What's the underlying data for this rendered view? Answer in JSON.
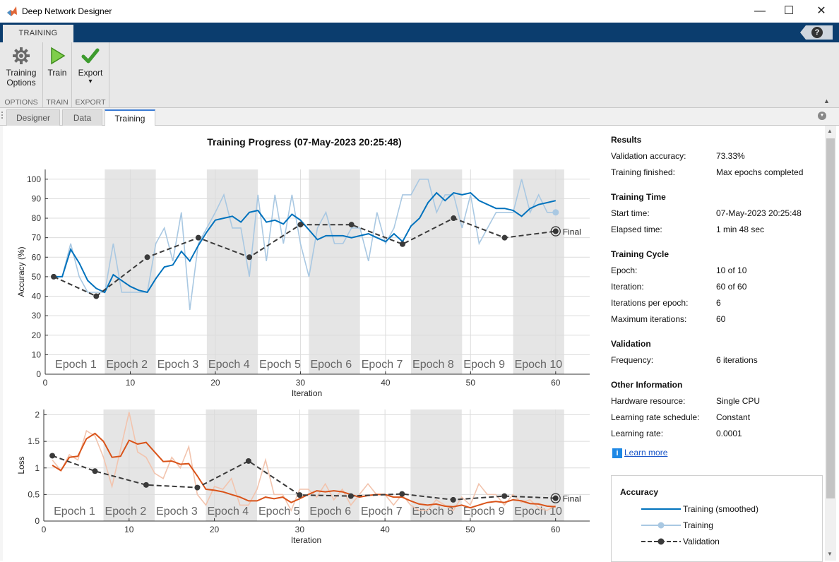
{
  "window": {
    "title": "Deep Network Designer",
    "minimize": "—",
    "maximize": "☐",
    "close": "✕"
  },
  "toolstrip": {
    "tab_label": "TRAINING",
    "help_label": "?",
    "groups": [
      {
        "label": "OPTIONS",
        "button": [
          "Training",
          "Options"
        ],
        "icon": "gear-icon"
      },
      {
        "label": "TRAIN",
        "button": [
          "Train"
        ],
        "icon": "play-icon"
      },
      {
        "label": "EXPORT",
        "button": [
          "Export",
          "▾"
        ],
        "icon": "checkmark-icon"
      }
    ]
  },
  "doc_tabs": [
    "Designer",
    "Data",
    "Training"
  ],
  "active_tab": "Training",
  "progress_title": "Training Progress (07-May-2023 20:25:48)",
  "info": {
    "sections": [
      {
        "title": "Results",
        "rows": [
          [
            "Validation accuracy:",
            "73.33%"
          ],
          [
            "Training finished:",
            "Max epochs completed"
          ]
        ]
      },
      {
        "title": "Training Time",
        "rows": [
          [
            "Start time:",
            "07-May-2023 20:25:48"
          ],
          [
            "Elapsed time:",
            "1 min 48 sec"
          ]
        ]
      },
      {
        "title": "Training Cycle",
        "rows": [
          [
            "Epoch:",
            "10 of 10"
          ],
          [
            "Iteration:",
            "60 of 60"
          ],
          [
            "Iterations per epoch:",
            "6"
          ],
          [
            "Maximum iterations:",
            "60"
          ]
        ]
      },
      {
        "title": "Validation",
        "rows": [
          [
            "Frequency:",
            "6 iterations"
          ]
        ]
      },
      {
        "title": "Other Information",
        "rows": [
          [
            "Hardware resource:",
            "Single CPU"
          ],
          [
            "Learning rate schedule:",
            "Constant"
          ],
          [
            "Learning rate:",
            "0.0001"
          ]
        ]
      }
    ],
    "learn_more": "Learn more"
  },
  "legend": {
    "title": "Accuracy",
    "entries": [
      "Training (smoothed)",
      "Training",
      "Validation"
    ]
  },
  "chart_data": [
    {
      "type": "line",
      "ylabel": "Accuracy (%)",
      "xlabel": "Iteration",
      "xlim": [
        0,
        64
      ],
      "ylim": [
        0,
        105
      ],
      "xticks": [
        0,
        10,
        20,
        30,
        40,
        50,
        60
      ],
      "yticks": [
        0,
        10,
        20,
        30,
        40,
        50,
        60,
        70,
        80,
        90,
        100
      ],
      "grid": true,
      "epoch_labels": [
        "Epoch 1",
        "Epoch 2",
        "Epoch 3",
        "Epoch 4",
        "Epoch 5",
        "Epoch 6",
        "Epoch 7",
        "Epoch 8",
        "Epoch 9",
        "Epoch 10"
      ],
      "colors": {
        "smoothed": "#0072bd",
        "raw": "#a9c8e2",
        "validation": "#3a3a3a",
        "shade": "#e5e5e5"
      },
      "series": [
        {
          "name": "Training (smoothed)",
          "x": [
            1,
            2,
            3,
            4,
            5,
            6,
            7,
            8,
            9,
            10,
            11,
            12,
            13,
            14,
            15,
            16,
            17,
            18,
            19,
            20,
            21,
            22,
            23,
            24,
            25,
            26,
            27,
            28,
            29,
            30,
            31,
            32,
            33,
            34,
            35,
            36,
            37,
            38,
            39,
            40,
            41,
            42,
            43,
            44,
            45,
            46,
            47,
            48,
            49,
            50,
            51,
            52,
            53,
            54,
            55,
            56,
            57,
            58,
            59,
            60
          ],
          "y": [
            50,
            50,
            64,
            57,
            48,
            44,
            42,
            51,
            48,
            45,
            43,
            42,
            49,
            55,
            56,
            63,
            58,
            66,
            73,
            79,
            80,
            81,
            78,
            83,
            84,
            78,
            79,
            77,
            82,
            79,
            74,
            69,
            71,
            71,
            71,
            70,
            71,
            72,
            70,
            68,
            72,
            68,
            76,
            80,
            88,
            93,
            89,
            93,
            92,
            93,
            89,
            87,
            85,
            85,
            84,
            81,
            85,
            87,
            88,
            89
          ]
        },
        {
          "name": "Training",
          "x": [
            1,
            2,
            3,
            4,
            5,
            6,
            7,
            8,
            9,
            10,
            11,
            12,
            13,
            14,
            15,
            16,
            17,
            18,
            19,
            20,
            21,
            22,
            23,
            24,
            25,
            26,
            27,
            28,
            29,
            30,
            31,
            32,
            33,
            34,
            35,
            36,
            37,
            38,
            39,
            40,
            41,
            42,
            43,
            44,
            45,
            46,
            47,
            48,
            49,
            50,
            51,
            52,
            53,
            54,
            55,
            56,
            57,
            58,
            59,
            60
          ],
          "y": [
            50,
            50,
            67,
            50,
            42,
            42,
            42,
            67,
            42,
            42,
            42,
            42,
            67,
            75,
            58,
            83,
            33,
            67,
            75,
            83,
            92,
            75,
            75,
            50,
            92,
            58,
            92,
            67,
            92,
            67,
            50,
            75,
            83,
            67,
            67,
            75,
            75,
            58,
            83,
            67,
            75,
            92,
            92,
            100,
            100,
            83,
            92,
            92,
            75,
            92,
            67,
            75,
            83,
            83,
            83,
            100,
            83,
            92,
            83,
            83
          ]
        },
        {
          "name": "Validation",
          "x": [
            1,
            6,
            12,
            18,
            24,
            30,
            36,
            42,
            48,
            54,
            60
          ],
          "y": [
            50,
            40,
            60,
            70,
            60,
            76.7,
            76.7,
            66.7,
            80,
            70,
            73.3
          ]
        }
      ],
      "annotation": "Final"
    },
    {
      "type": "line",
      "ylabel": "Loss",
      "xlabel": "Iteration",
      "xlim": [
        0,
        64
      ],
      "ylim": [
        0,
        2.1
      ],
      "xticks": [
        0,
        10,
        20,
        30,
        40,
        50,
        60
      ],
      "yticks": [
        0,
        0.5,
        1,
        1.5,
        2
      ],
      "ytick_labels": [
        "0",
        "0.5",
        "1",
        "1.5",
        "2"
      ],
      "grid": true,
      "epoch_labels": [
        "Epoch 1",
        "Epoch 2",
        "Epoch 3",
        "Epoch 4",
        "Epoch 5",
        "Epoch 6",
        "Epoch 7",
        "Epoch 8",
        "Epoch 9",
        "Epoch 10"
      ],
      "colors": {
        "smoothed": "#d95319",
        "raw": "#f2c4ae",
        "validation": "#3a3a3a",
        "shade": "#e5e5e5"
      },
      "series": [
        {
          "name": "Training (smoothed)",
          "x": [
            1,
            2,
            3,
            4,
            5,
            6,
            7,
            8,
            9,
            10,
            11,
            12,
            13,
            14,
            15,
            16,
            17,
            18,
            19,
            20,
            21,
            22,
            23,
            24,
            25,
            26,
            27,
            28,
            29,
            30,
            31,
            32,
            33,
            34,
            35,
            36,
            37,
            38,
            39,
            40,
            41,
            42,
            43,
            44,
            45,
            46,
            47,
            48,
            49,
            50,
            51,
            52,
            53,
            54,
            55,
            56,
            57,
            58,
            59,
            60
          ],
          "y": [
            1.05,
            0.95,
            1.2,
            1.22,
            1.55,
            1.65,
            1.5,
            1.2,
            1.22,
            1.52,
            1.45,
            1.48,
            1.3,
            1.12,
            1.13,
            1.07,
            1.08,
            0.85,
            0.6,
            0.58,
            0.55,
            0.5,
            0.45,
            0.38,
            0.38,
            0.45,
            0.42,
            0.45,
            0.35,
            0.42,
            0.5,
            0.57,
            0.55,
            0.57,
            0.55,
            0.5,
            0.45,
            0.48,
            0.5,
            0.5,
            0.45,
            0.45,
            0.38,
            0.32,
            0.3,
            0.32,
            0.28,
            0.27,
            0.3,
            0.25,
            0.3,
            0.35,
            0.37,
            0.35,
            0.4,
            0.38,
            0.33,
            0.32,
            0.28,
            0.27
          ]
        },
        {
          "name": "Training",
          "x": [
            1,
            2,
            3,
            4,
            5,
            6,
            7,
            8,
            9,
            10,
            11,
            12,
            13,
            14,
            15,
            16,
            17,
            18,
            19,
            20,
            21,
            22,
            23,
            24,
            25,
            26,
            27,
            28,
            29,
            30,
            31,
            32,
            33,
            34,
            35,
            36,
            37,
            38,
            39,
            40,
            41,
            42,
            43,
            44,
            45,
            46,
            47,
            48,
            49,
            50,
            51,
            52,
            53,
            54,
            55,
            56,
            57,
            58,
            59,
            60
          ],
          "y": [
            1.15,
            0.95,
            1.25,
            1.15,
            1.7,
            1.6,
            1.2,
            0.65,
            1.35,
            2.05,
            1.3,
            1.2,
            0.9,
            0.8,
            1.2,
            1.0,
            1.4,
            0.5,
            0.3,
            0.65,
            0.6,
            0.8,
            0.3,
            0.3,
            0.6,
            1.15,
            0.5,
            0.5,
            0.2,
            0.6,
            0.6,
            0.45,
            0.7,
            0.4,
            0.6,
            0.3,
            0.5,
            0.7,
            0.5,
            0.5,
            0.3,
            0.5,
            0.3,
            0.2,
            0.2,
            0.4,
            0.3,
            0.2,
            0.45,
            0.3,
            0.7,
            0.5,
            0.5,
            0.3,
            0.5,
            0.35,
            0.4,
            0.25,
            0.2,
            0.3
          ]
        },
        {
          "name": "Validation",
          "x": [
            1,
            6,
            12,
            18,
            24,
            30,
            36,
            42,
            48,
            54,
            60
          ],
          "y": [
            1.23,
            0.94,
            0.68,
            0.63,
            1.13,
            0.49,
            0.47,
            0.51,
            0.4,
            0.47,
            0.43
          ]
        }
      ],
      "annotation": "Final"
    }
  ]
}
